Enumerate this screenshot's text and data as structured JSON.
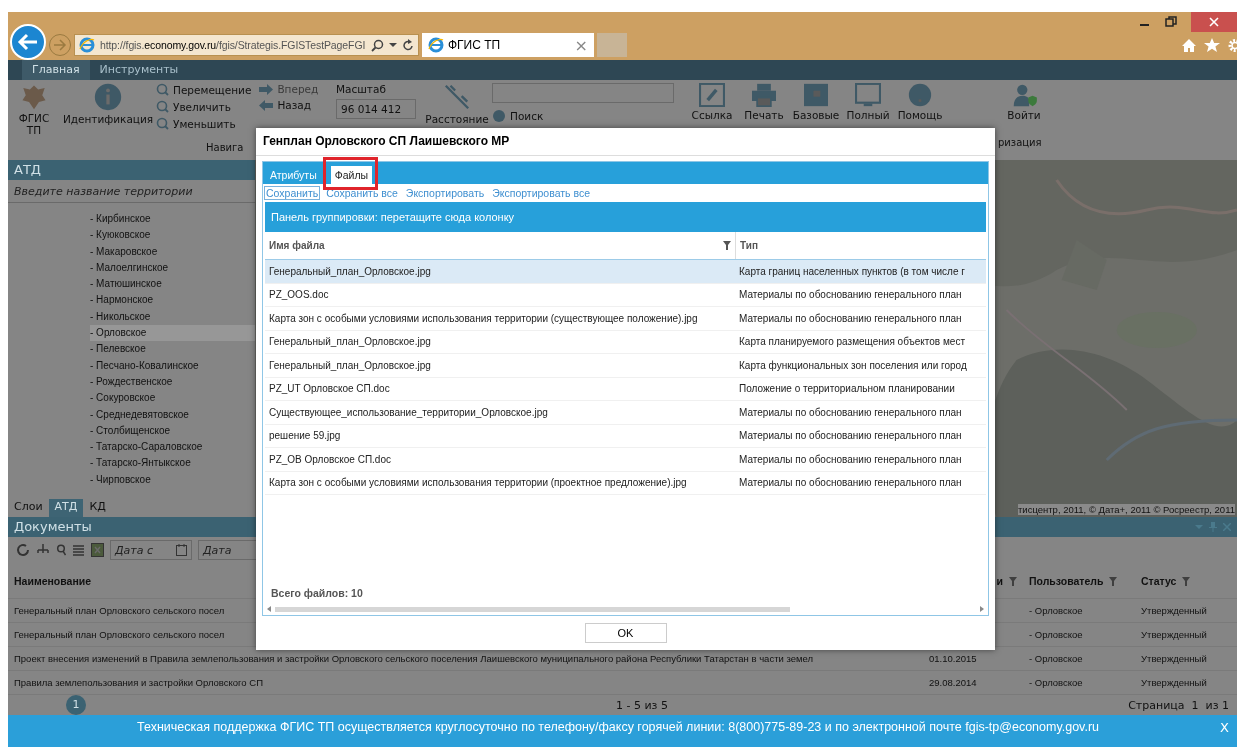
{
  "browser": {
    "url": "http://fgis.**economy.gov.ru**/fgis/Strategis.FGISTestPageFGI",
    "tab": {
      "title": "ФГИС ТП",
      "close": "×"
    }
  },
  "app_tabs": [
    {
      "label": "Главная",
      "selected": true
    },
    {
      "label": "Инструменты",
      "selected": false
    }
  ],
  "ribbon": {
    "logo": "ФГИС ТП",
    "identify": "Идентификация",
    "nav": [
      "Перемещение",
      "Увеличить",
      "Уменьшить"
    ],
    "history": [
      {
        "label": "Вперед",
        "disabled": true
      },
      {
        "label": "Назад",
        "disabled": false
      }
    ],
    "nav_group": "Навига",
    "scale_label": "Масштаб",
    "scale_value": "96 014 412",
    "distance": "Расстояние",
    "search": "Поиск",
    "tools": [
      "Ссылка",
      "Печать",
      "Базовые",
      "Полный",
      "Помощь"
    ],
    "login": "Войти",
    "auth_group": "ризация"
  },
  "sidebar": {
    "title": "АТД",
    "placeholder": "Введите название территории",
    "items": [
      {
        "label": "- Кирбинское",
        "selected": false
      },
      {
        "label": "- Куюковское",
        "selected": false
      },
      {
        "label": "- Макаровское",
        "selected": false
      },
      {
        "label": "- Малоелгинское",
        "selected": false
      },
      {
        "label": "- Матюшинское",
        "selected": false
      },
      {
        "label": "- Нармонское",
        "selected": false
      },
      {
        "label": "- Никольское",
        "selected": false
      },
      {
        "label": "- Орловское",
        "selected": true
      },
      {
        "label": "- Пелевское",
        "selected": false
      },
      {
        "label": "- Песчано-Ковалинское",
        "selected": false
      },
      {
        "label": "- Рождественское",
        "selected": false
      },
      {
        "label": "- Сокуровское",
        "selected": false
      },
      {
        "label": "- Среднедевятовское",
        "selected": false
      },
      {
        "label": "- Столбищенское",
        "selected": false
      },
      {
        "label": "- Татарско-Сараловское",
        "selected": false
      },
      {
        "label": "- Татарско-Янтыкское",
        "selected": false
      },
      {
        "label": "- Чирповское",
        "selected": false
      }
    ],
    "tabs": [
      {
        "label": "Слои",
        "selected": false
      },
      {
        "label": "АТД",
        "selected": true
      },
      {
        "label": "КД",
        "selected": false
      }
    ]
  },
  "map": {
    "attribution": "тисцентр, 2011, © Дата+, 2011 © Росреестр, 2011"
  },
  "documents": {
    "title": "Документы",
    "date_from": "Дата с",
    "date_to": "Дата",
    "columns": [
      "Наименование",
      "и",
      "Пользователь",
      "Статус"
    ],
    "rows": [
      {
        "name": "Генеральный план Орловского сельского посел",
        "user": "- Орловское",
        "status": "Утвержденный"
      },
      {
        "name": "Генеральный план Орловского сельского посел",
        "user": "- Орловское",
        "status": "Утвержденный"
      },
      {
        "name": "Проект внесения изменений в Правила землепользования и застройки Орловского сельского поселения Лаишевского муниципального района Республики Татарстан в части земел",
        "date": "01.10.2015",
        "user": "- Орловское",
        "status": "Утвержденный"
      },
      {
        "name": "Правила землепользования и застройки Орловского СП",
        "date": "29.08.2014",
        "user": "- Орловское",
        "status": "Утвержденный"
      }
    ],
    "pager": {
      "page": "1",
      "range": "1 - 5 из 5",
      "info": "Страница  1  из 1"
    }
  },
  "dialog": {
    "title": "Генплан Орловского СП Лаишевского МР",
    "tabs": [
      {
        "label": "Атрибуты",
        "selected": false
      },
      {
        "label": "Файлы",
        "selected": true
      }
    ],
    "actions": [
      {
        "label": "Сохранить",
        "focused": true
      },
      {
        "label": "Сохранить все",
        "focused": false
      },
      {
        "label": "Экспортировать",
        "focused": false
      },
      {
        "label": "Экспортировать все",
        "focused": false
      }
    ],
    "group_panel": "Панель группировки: перетащите сюда колонку",
    "columns": [
      "Имя файла",
      "Тип"
    ],
    "rows": [
      {
        "name": "Генеральный_план_Орловское.jpg",
        "type": "Карта границ населенных пунктов (в том числе г",
        "selected": true
      },
      {
        "name": "PZ_OOS.doc",
        "type": "Материалы по обоснованию генерального план",
        "selected": false
      },
      {
        "name": "Карта зон с особыми условиями использования территории (существующее положение).jpg",
        "type": "Материалы по обоснованию генерального план",
        "selected": false
      },
      {
        "name": "Генеральный_план_Орловское.jpg",
        "type": "Карта планируемого размещения объектов мест",
        "selected": false
      },
      {
        "name": "Генеральный_план_Орловское.jpg",
        "type": "Карта функциональных зон поселения или город",
        "selected": false
      },
      {
        "name": "PZ_UT Орловское СП.doc",
        "type": "Положение о территориальном планировании",
        "selected": false
      },
      {
        "name": "Существующее_использование_территории_Орловское.jpg",
        "type": "Материалы по обоснованию генерального план",
        "selected": false
      },
      {
        "name": "решение 59.jpg",
        "type": "Материалы по обоснованию генерального план",
        "selected": false
      },
      {
        "name": "PZ_OB Орловское СП.doc",
        "type": "Материалы по обоснованию генерального план",
        "selected": false
      },
      {
        "name": "Карта зон с особыми условиями использования территории (проектное предложение).jpg",
        "type": "Материалы по обоснованию генерального план",
        "selected": false
      }
    ],
    "total": "Всего файлов: 10",
    "ok": "OK"
  },
  "footer": {
    "text": "Техническая поддержка ФГИС ТП осуществляется круглосуточно по телефону/факсу горячей линии: 8(800)775-89-23 и по электронной почте fgis-tp@economy.gov.ru",
    "close": "X"
  }
}
